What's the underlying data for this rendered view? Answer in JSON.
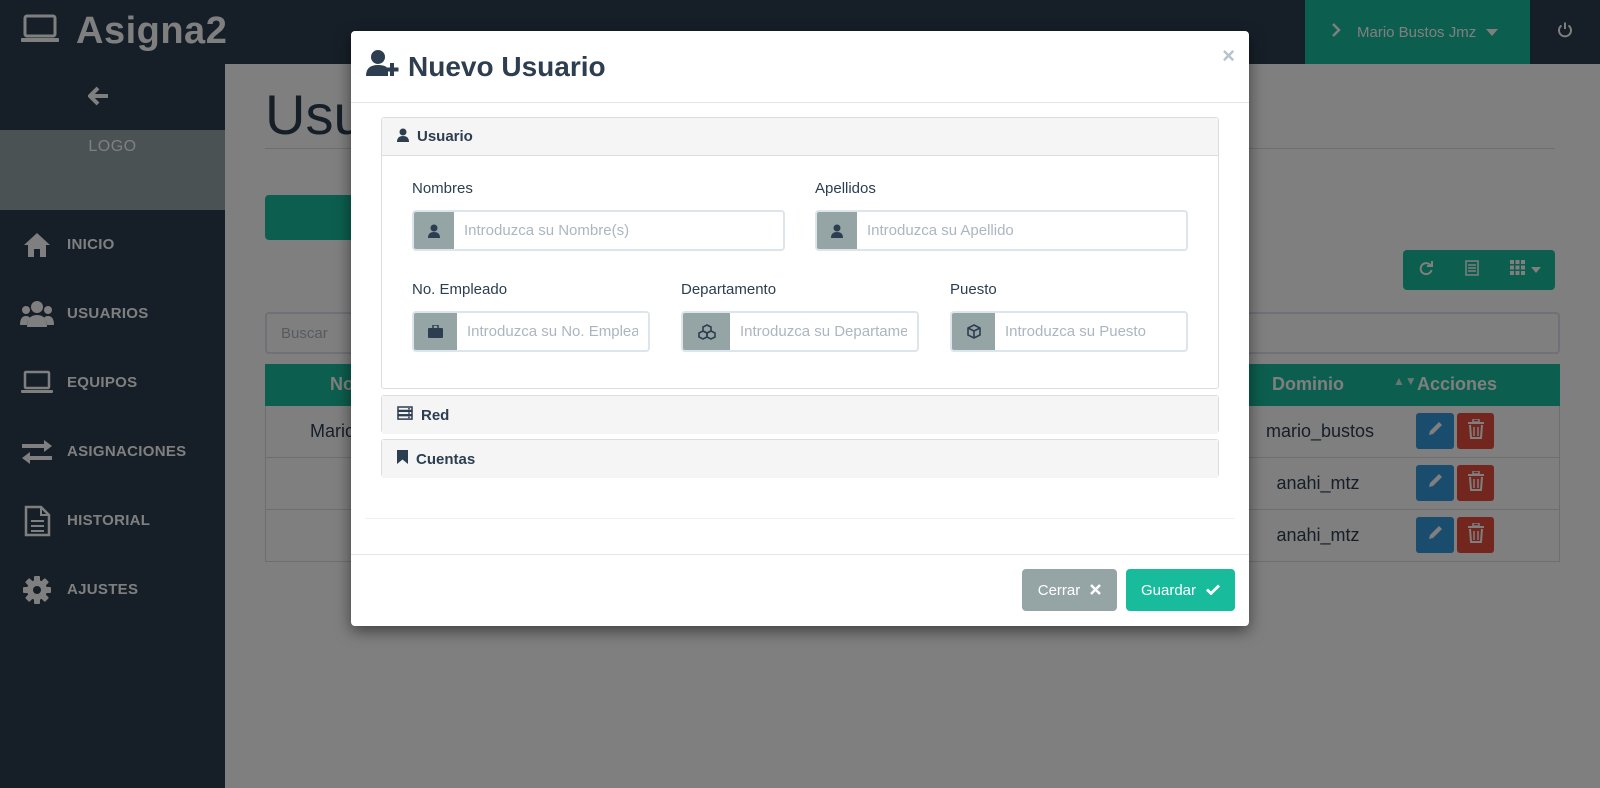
{
  "app": {
    "brand": "Asigna2",
    "logo_text": "LOGO"
  },
  "topbar": {
    "user_name": "Mario Bustos Jmz"
  },
  "sidebar": {
    "items": [
      {
        "label": "INICIO",
        "icon": "home-icon"
      },
      {
        "label": "USUARIOS",
        "icon": "users-icon"
      },
      {
        "label": "EQUIPOS",
        "icon": "laptop-icon"
      },
      {
        "label": "ASIGNACIONES",
        "icon": "exchange-icon"
      },
      {
        "label": "HISTORIAL",
        "icon": "document-icon"
      },
      {
        "label": "AJUSTES",
        "icon": "gear-icon"
      }
    ]
  },
  "main": {
    "title": "Usu",
    "search_placeholder": "Buscar",
    "table": {
      "headers": {
        "first_col": "No",
        "domain": "Dominio",
        "actions": "Acciones"
      },
      "rows": [
        {
          "name": "Mario",
          "domain": "mario_bustos"
        },
        {
          "name": "",
          "domain": "anahi_mtz"
        },
        {
          "name": "",
          "domain": "anahi_mtz"
        }
      ]
    }
  },
  "modal": {
    "title": "Nuevo Usuario",
    "close_glyph": "×",
    "sections": {
      "usuario": "Usuario",
      "red": "Red",
      "cuentas": "Cuentas"
    },
    "fields": {
      "nombres": {
        "label": "Nombres",
        "placeholder": "Introduzca su Nombre(s)",
        "value": ""
      },
      "apellidos": {
        "label": "Apellidos",
        "placeholder": "Introduzca su Apellido",
        "value": ""
      },
      "empleado": {
        "label": "No. Empleado",
        "placeholder": "Introduzca su No. Empleado",
        "value": ""
      },
      "departamento": {
        "label": "Departamento",
        "placeholder": "Introduzca su Departamento",
        "value": ""
      },
      "puesto": {
        "label": "Puesto",
        "placeholder": "Introduzca su Puesto",
        "value": ""
      }
    },
    "buttons": {
      "cerrar": "Cerrar",
      "guardar": "Guardar"
    }
  },
  "colors": {
    "navy": "#2c3e50",
    "accent": "#18bc9c",
    "gray": "#95a5a6",
    "blue": "#3498db",
    "red": "#e74c3c"
  }
}
